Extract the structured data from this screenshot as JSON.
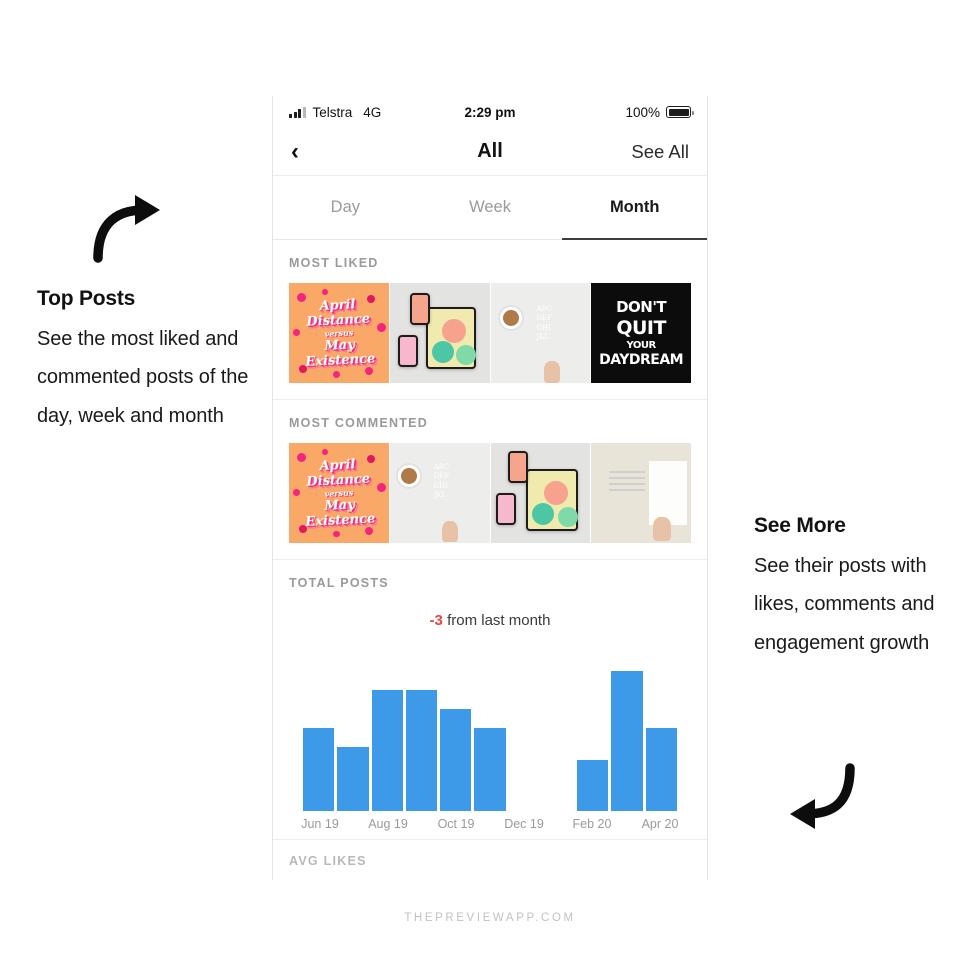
{
  "watermark": "THEPREVIEWAPP.COM",
  "annotations": {
    "left": {
      "title": "Top Posts",
      "body": "See the most liked and commented posts of the day, week and month",
      "arrow": "curved-arrow-up-right"
    },
    "right": {
      "title": "See More",
      "body": "See their posts with likes, comments and engagement growth",
      "arrow": "curved-arrow-down-left"
    }
  },
  "phone": {
    "status_bar": {
      "carrier": "Telstra",
      "network": "4G",
      "time": "2:29 pm",
      "battery_percent": "100%",
      "signal_icon": "signal-bars-icon",
      "battery_icon": "battery-full-icon"
    },
    "nav": {
      "back_icon": "chevron-left-icon",
      "title": "All",
      "action_label": "See All"
    },
    "tabs": [
      {
        "label": "Day",
        "active": false
      },
      {
        "label": "Week",
        "active": false
      },
      {
        "label": "Month",
        "active": true
      }
    ],
    "sections": {
      "most_liked": {
        "title": "MOST LIKED",
        "thumbnails": [
          {
            "name": "april-distance-may-existence-lettering",
            "style": "april"
          },
          {
            "name": "tablet-phone-pears-flatlay",
            "style": "desk"
          },
          {
            "name": "coffee-tablet-alphabet-lettering",
            "style": "coffee"
          },
          {
            "name": "dont-quit-your-daydream-chalk",
            "style": "black"
          }
        ]
      },
      "most_commented": {
        "title": "MOST COMMENTED",
        "thumbnails": [
          {
            "name": "april-distance-may-existence-lettering",
            "style": "april"
          },
          {
            "name": "coffee-tablet-alphabet-lettering",
            "style": "coffee"
          },
          {
            "name": "tablet-phone-pears-flatlay",
            "style": "desk"
          },
          {
            "name": "tablet-sketch-linework",
            "style": "sketch"
          }
        ]
      },
      "total_posts": {
        "title": "TOTAL POSTS",
        "delta_value": "-3",
        "delta_label": "from last month",
        "delta_color": "#e8453c"
      },
      "avg_likes": {
        "title": "AVG LIKES"
      }
    }
  },
  "chart_data": {
    "type": "bar",
    "title": "TOTAL POSTS",
    "annotation": "-3 from last month",
    "xlabel": "",
    "ylabel": "",
    "grid": false,
    "legend": false,
    "bar_color": "#3d9ae8",
    "categories": [
      "Jun 19",
      "Jul 19",
      "Aug 19",
      "Sep 19",
      "Oct 19",
      "Nov 19",
      "Dec 19",
      "Jan 20",
      "Feb 20",
      "Mar 20",
      "Apr 20"
    ],
    "tick_labels": [
      "Jun 19",
      "Aug 19",
      "Oct 19",
      "Dec 19",
      "Feb 20",
      "Apr 20"
    ],
    "values": [
      13,
      10,
      19,
      19,
      16,
      13,
      0,
      0,
      8,
      22,
      13
    ],
    "ylim": [
      0,
      24
    ]
  }
}
